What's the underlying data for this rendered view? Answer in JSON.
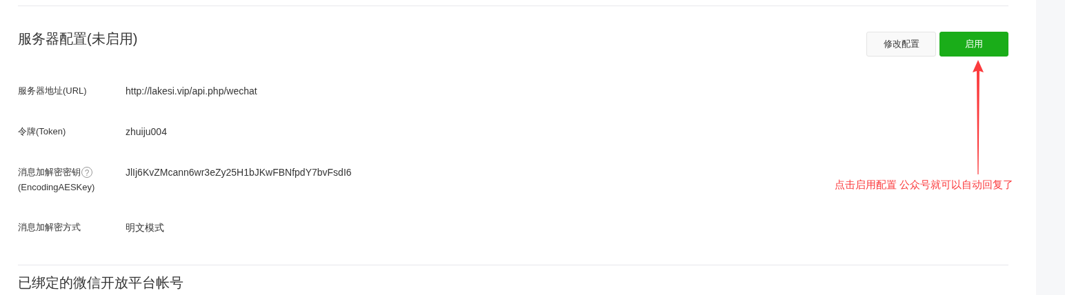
{
  "section": {
    "title": "服务器配置(未启用)",
    "buttons": [
      {
        "label": "修改配置",
        "kind": "secondary"
      },
      {
        "label": "启用",
        "kind": "primary"
      }
    ],
    "fields": [
      {
        "label": "服务器地址(URL)",
        "value": "http://lakesi.vip/api.php/wechat"
      },
      {
        "label": "令牌(Token)",
        "value": "zhuiju004"
      },
      {
        "label": "消息加解密密钥",
        "help": "?",
        "label_2": "(EncodingAESKey)",
        "value": "JlIj6KvZMcann6wr3eZy25H1bJKwFBNfpdY7bvFsdI6"
      },
      {
        "label": "消息加解密方式",
        "value": "明文模式"
      }
    ]
  },
  "annotation": {
    "text": "点击启用配置 公众号就可以自动回复了"
  },
  "next_section": {
    "title": "已绑定的微信开放平台帐号"
  }
}
